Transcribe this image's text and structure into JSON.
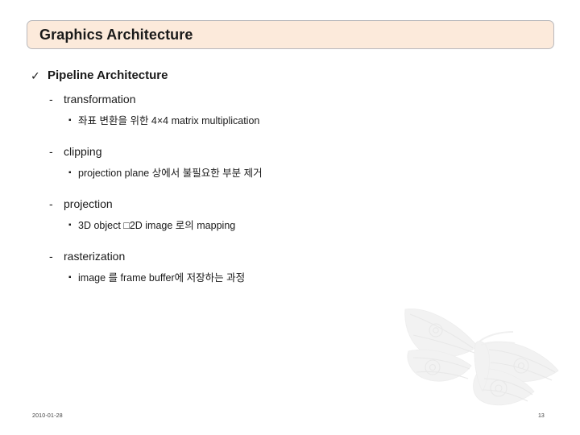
{
  "slide": {
    "title": "Graphics Architecture",
    "title_background": "#fceadb",
    "title_border": "#b9b9bd",
    "background": "#ffffff",
    "text_color": "#1a1a1a"
  },
  "outline": {
    "level1": {
      "marker": "✓",
      "marker_name": "check-mark",
      "label": "Pipeline Architecture"
    },
    "groups": [
      {
        "marker": "-",
        "label": "transformation",
        "detail_marker": "▪",
        "detail": "좌표 변환을 위한 4×4 matrix multiplication"
      },
      {
        "marker": "-",
        "label": "clipping",
        "detail_marker": "▪",
        "detail": "projection plane 상에서 불필요한 부분 제거"
      },
      {
        "marker": "-",
        "label": "projection",
        "detail_marker": "▪",
        "detail": "3D object □2D image 로의 mapping"
      },
      {
        "marker": "-",
        "label": "rasterization",
        "detail_marker": "▪",
        "detail": "image 를 frame buffer에 저장하는 과정"
      }
    ]
  },
  "watermark": {
    "icon": "moth-watermark",
    "color": "#f1f1f1"
  },
  "footer": {
    "date": "2010-01-28",
    "page_number": "13"
  }
}
